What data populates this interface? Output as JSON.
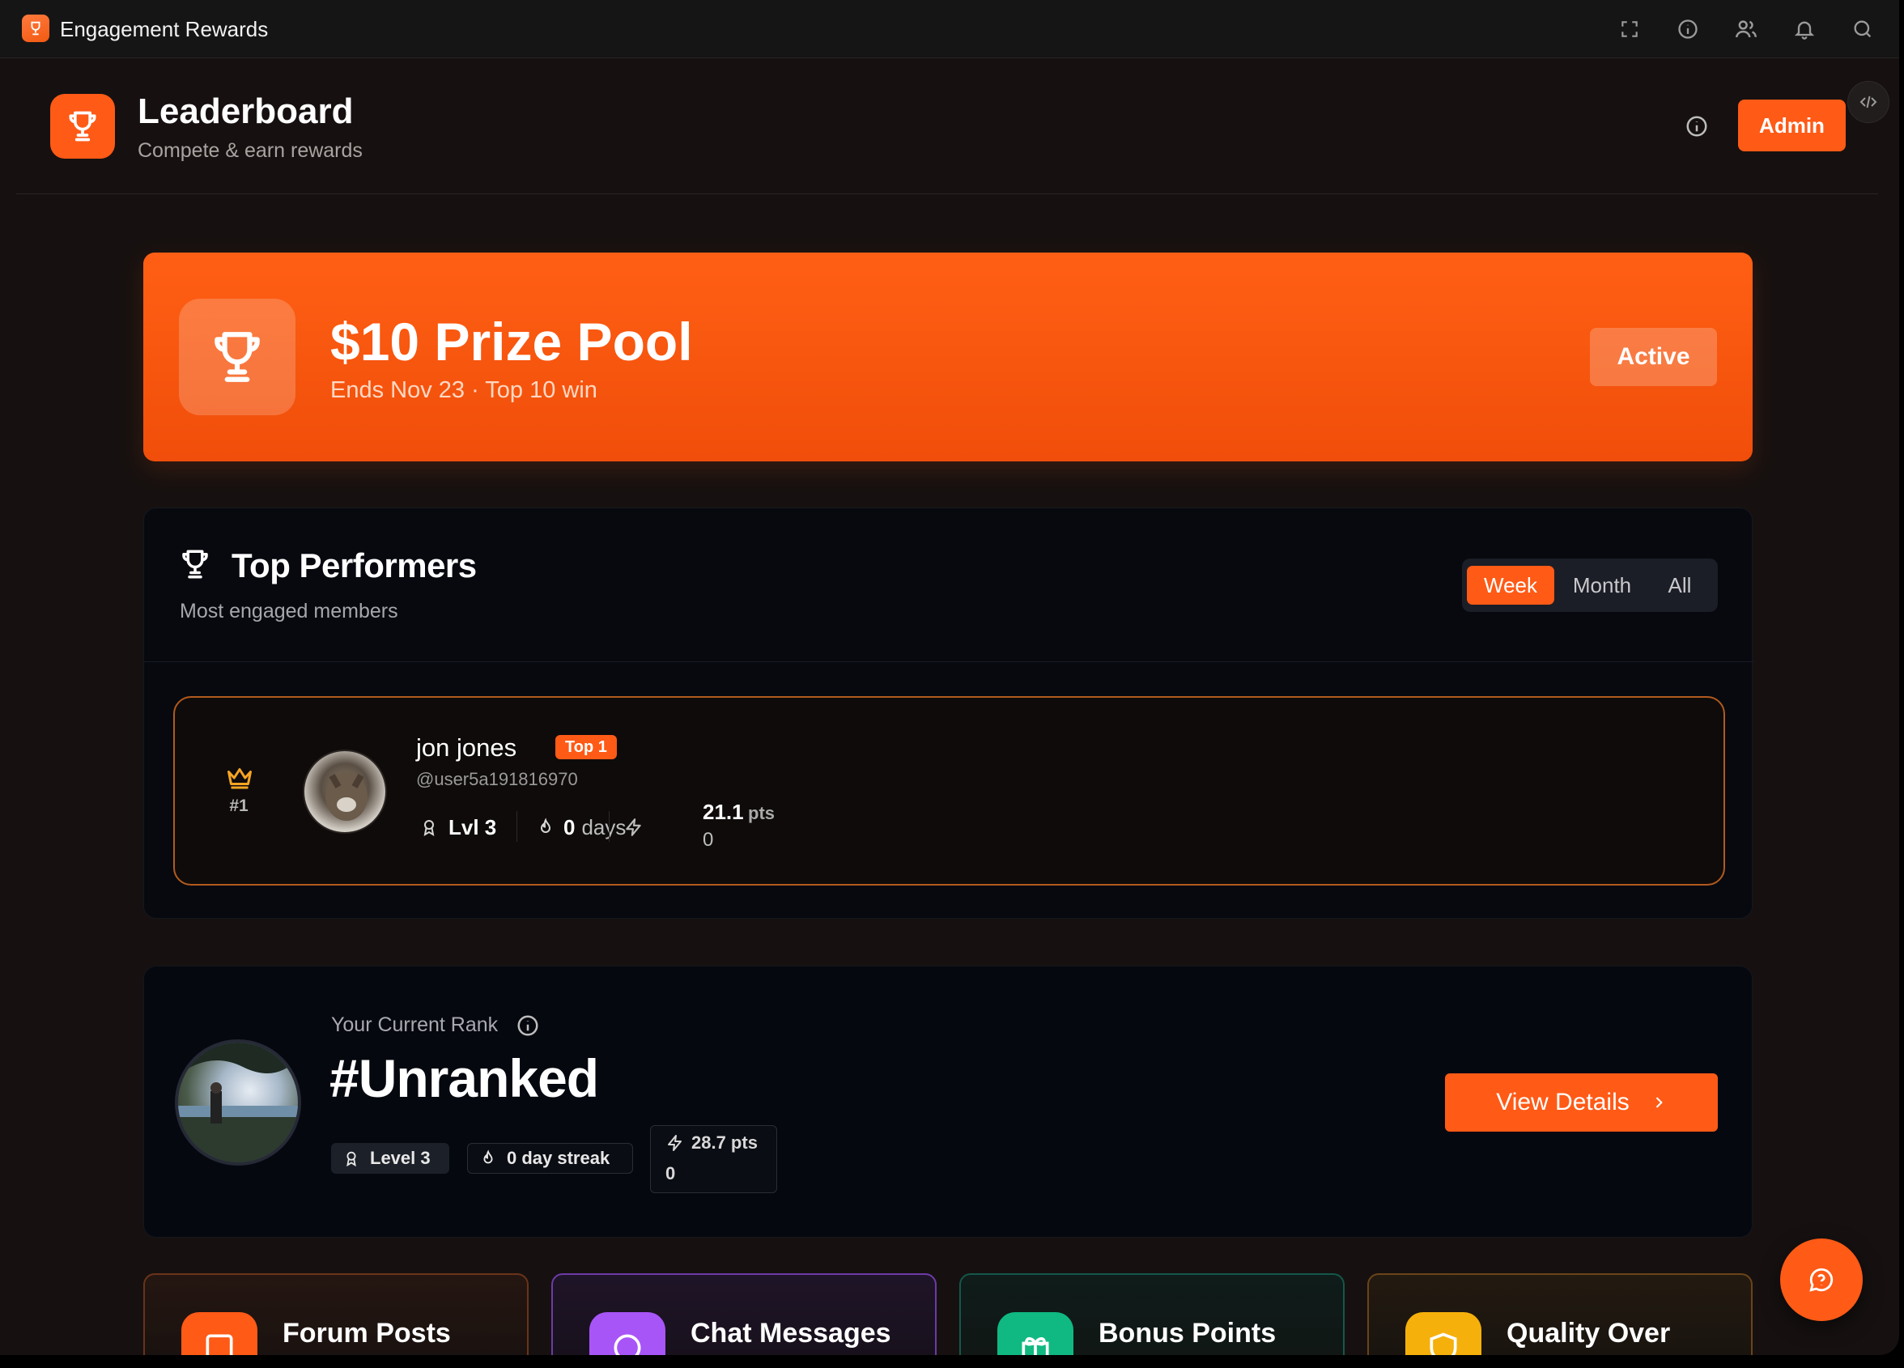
{
  "app": {
    "title": "Engagement Rewards"
  },
  "titlebar_icons": [
    "fullscreen-icon",
    "info-icon",
    "users-icon",
    "bell-icon",
    "search-icon"
  ],
  "header": {
    "title": "Leaderboard",
    "subtitle": "Compete & earn rewards",
    "admin_label": "Admin"
  },
  "prize": {
    "title": "$10 Prize Pool",
    "subtitle": "Ends Nov 23 · Top 10 win",
    "status": "Active"
  },
  "performers": {
    "title": "Top Performers",
    "subtitle": "Most engaged members",
    "tabs": [
      {
        "label": "Week",
        "active": true
      },
      {
        "label": "Month",
        "active": false
      },
      {
        "label": "All",
        "active": false
      }
    ],
    "entries": [
      {
        "rank": "#1",
        "name": "jon jones",
        "badge": "Top 1",
        "handle": "@user5a191816970",
        "level_label": "Lvl 3",
        "streak_value": "0",
        "streak_unit": "days",
        "points_value": "21.1",
        "points_unit": "pts",
        "points_extra": "0"
      }
    ]
  },
  "my_rank": {
    "label": "Your Current Rank",
    "value": "#Unranked",
    "level": "Level 3",
    "streak": "0 day streak",
    "points": "28.7 pts",
    "points_extra": "0",
    "button_label": "View Details"
  },
  "categories": [
    {
      "label": "Forum Posts",
      "icon": "forum-icon",
      "color": "#ff5a16"
    },
    {
      "label": "Chat Messages",
      "icon": "chat-icon",
      "color": "#a855f7"
    },
    {
      "label": "Bonus Points",
      "icon": "gift-icon",
      "color": "#10b981"
    },
    {
      "label": "Quality Over",
      "icon": "shield-icon",
      "color": "#f59e0b"
    }
  ],
  "colors": {
    "accent": "#ff5a16",
    "background": "#161110",
    "card": "#07090f"
  }
}
